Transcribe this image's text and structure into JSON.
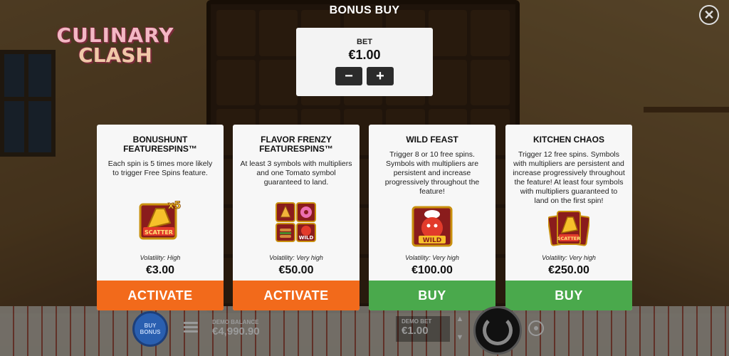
{
  "logo": {
    "line1": "CULINARY",
    "line2": "CLASH"
  },
  "title": "BONUS BUY",
  "close_icon": "close-icon",
  "bet": {
    "label": "BET",
    "value": "€1.00",
    "decrease": "−",
    "increase": "+"
  },
  "cards": [
    {
      "title": "BONUSHUNT\nFEATURESPINS™",
      "description": "Each spin is 5 times more likely to trigger Free Spins feature.",
      "icon": "scatter-x5-icon",
      "icon_text": "SCATTER",
      "multiplier": "x5",
      "volatility": "Volatility: High",
      "price": "€3.00",
      "button": "ACTIVATE",
      "button_color": "#f26a1b"
    },
    {
      "title": "FLAVOR FRENZY\nFEATURESPINS™",
      "description": "At least 3 symbols with multipliers and one Tomato symbol guaranteed to land.",
      "icon": "food-symbols-icon",
      "icon_text": "WILD",
      "volatility": "Volatility: Very high",
      "price": "€50.00",
      "button": "ACTIVATE",
      "button_color": "#f26a1b"
    },
    {
      "title": "WILD FEAST",
      "description": "Trigger 8 or 10 free spins. Symbols with multipliers are persistent and increase progressively throughout the feature!",
      "icon": "tomato-wild-icon",
      "icon_text": "WILD",
      "volatility": "Volatility: Very high",
      "price": "€100.00",
      "button": "BUY",
      "button_color": "#4aa94c"
    },
    {
      "title": "KITCHEN CHAOS",
      "description": "Trigger 12 free spins. Symbols with multipliers are persistent and increase progressively throughout the feature! At least four symbols with multipliers guaranteed to land on the first spin!",
      "icon": "scatter-stack-icon",
      "icon_text": "SCATTER",
      "volatility": "Volatility: Very high",
      "price": "€250.00",
      "button": "BUY",
      "button_color": "#4aa94c"
    }
  ],
  "bottom_bar": {
    "buy_bonus": "BUY BONUS",
    "demo_balance_label": "DEMO BALANCE",
    "demo_balance_value": "€4,990.90",
    "demo_bet_label": "DEMO BET",
    "demo_bet_value": "€1.00"
  }
}
